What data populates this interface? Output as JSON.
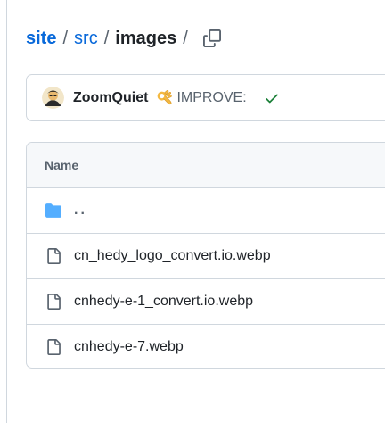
{
  "breadcrumb": {
    "items": [
      {
        "label": "site"
      },
      {
        "label": "src"
      }
    ],
    "separator": "/",
    "current": "images",
    "trailing_separator": "/",
    "copy_icon": "copy-icon"
  },
  "commit": {
    "avatar_icon": "avatar",
    "author": "ZoomQuiet",
    "emoji_icon": "ok-hand-icon",
    "message": "IMPROVE:",
    "status_icon": "check-icon",
    "status_color": "#1a7f37"
  },
  "file_table": {
    "header": "Name",
    "rows": [
      {
        "label": "..",
        "icon": "folder-icon",
        "icon_color": "#54aeff"
      },
      {
        "label": "cn_hedy_logo_convert.io.webp",
        "icon": "file-icon"
      },
      {
        "label": "cnhedy-e-1_convert.io.webp",
        "icon": "file-icon"
      },
      {
        "label": "cnhedy-e-7.webp",
        "icon": "file-icon"
      }
    ]
  },
  "colors": {
    "link": "#0969da",
    "text": "#1f2328",
    "muted": "#59636e",
    "border": "#d0d7de",
    "header_bg": "#f6f8fa"
  }
}
